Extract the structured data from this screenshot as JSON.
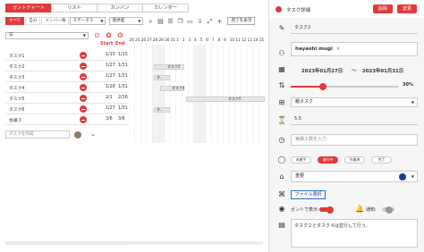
{
  "view_tabs": [
    "ガントチャート",
    "リスト",
    "カンバン",
    "カレンダー"
  ],
  "toolbar": {
    "chips": [
      "すべて",
      "自分",
      "メンバー毎"
    ],
    "status_select": "ステータス",
    "progress_select": "進捗度",
    "icons": [
      "search-icon",
      "filter-icon",
      "list-icon",
      "copy-icon",
      "folder-icon",
      "download-icon",
      "expand-icon",
      "add-icon"
    ],
    "done_toggle_label": "完了を表示"
  },
  "zoom_select": "日",
  "headers": {
    "start": "Start",
    "end": "End"
  },
  "tasks": [
    {
      "name": "タスク1",
      "start": "1/15",
      "end": "1/15"
    },
    {
      "name": "タスク2",
      "start": "1/27",
      "end": "1/31"
    },
    {
      "name": "タスク3",
      "start": "1/27",
      "end": "1/31"
    },
    {
      "name": "タスク4",
      "start": "1/28",
      "end": "1/31"
    },
    {
      "name": "タスク5",
      "start": "2/1",
      "end": "2/16"
    },
    {
      "name": "タスク6",
      "start": "1/27",
      "end": "1/31"
    },
    {
      "name": "会議３",
      "start": "3/6",
      "end": "3/6"
    }
  ],
  "new_task_placeholder": "タスクを作成",
  "gantt": {
    "day_labels": [
      "24",
      "25",
      "26",
      "27",
      "28",
      "29",
      "30",
      "31",
      "1",
      "2",
      "3",
      "4",
      "5",
      "6",
      "7",
      "8",
      "9",
      "10",
      "11",
      "12",
      "13",
      "14",
      "15"
    ],
    "bar_labels": [
      "タスク2",
      "タ...",
      "タスク4",
      "タスク5",
      "タ..."
    ]
  },
  "panel": {
    "title": "タスク詳細",
    "delete_label": "削除",
    "change_label": "変更",
    "task_name": "タスク2",
    "assignee": "hayashi mugi",
    "remove_mark": "×",
    "start_date": "2023年01月27日",
    "date_sep": "〜",
    "end_date": "2023年01月31日",
    "progress_percent": 30,
    "progress_label": "30%",
    "parent_task": "親タスク",
    "estimate": "5.5",
    "actual_placeholder": "実績工数を入力",
    "statuses": [
      "未着手",
      "進行中",
      "作業済",
      "完了"
    ],
    "active_status_index": 1,
    "importance": "重要",
    "importance_color": "#1f3a93",
    "file_button": "ファイル選択",
    "gantt_display_label": "ガントで表示:",
    "gantt_display_on": true,
    "notify_label": "通知:",
    "notify_on": false,
    "memo": "タスク２とタスク４は並行して行う。",
    "accent_color": "#e03a3a"
  }
}
